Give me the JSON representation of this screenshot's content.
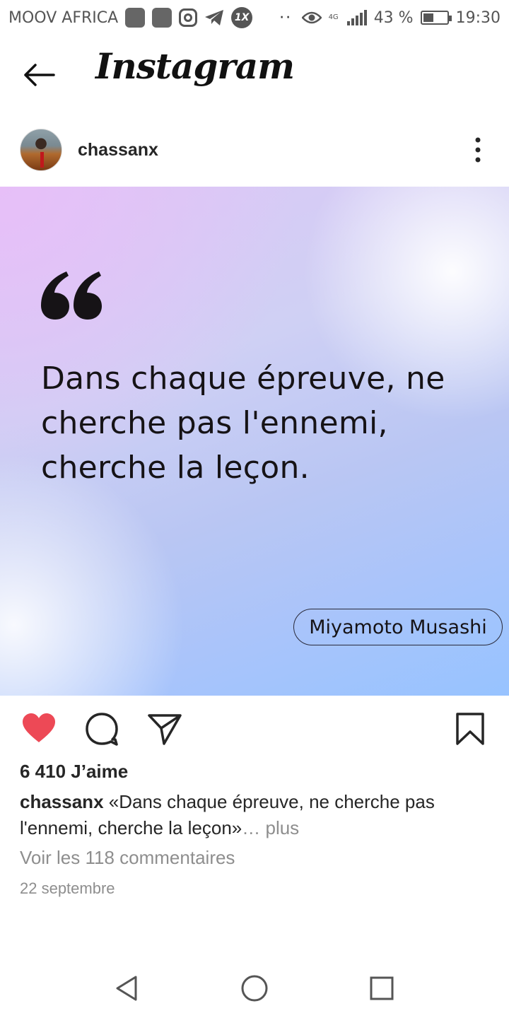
{
  "status_bar": {
    "carrier": "MOOV AFRICA",
    "network": "4G",
    "battery": "43 %",
    "time": "19:30",
    "overflow_dots": "··"
  },
  "app_bar": {
    "title": "Instagram"
  },
  "post": {
    "username": "chassanx",
    "image": {
      "quote": "Dans chaque épreuve, ne cherche pas l'ennemi, cherche la leçon.",
      "author": "Miyamoto Musashi"
    },
    "liked": true,
    "likes": "6 410 J’aime",
    "caption_user": "chassanx",
    "caption_text": " «Dans chaque épreuve, ne cherche pas l'ennemi, cherche la leçon»",
    "caption_more": "… plus",
    "comments_link": "Voir les 118 commentaires",
    "date": "22 septembre"
  },
  "icons": {
    "back": "arrow-left-icon",
    "more": "more-vertical-icon",
    "like": "heart-icon",
    "comment": "comment-icon",
    "share": "send-icon",
    "save": "bookmark-icon",
    "nav_back": "triangle-back-icon",
    "nav_home": "circle-home-icon",
    "nav_recents": "square-recents-icon"
  },
  "colors": {
    "like_red": "#ed4956",
    "text": "#262626",
    "muted": "#8e8e8e"
  }
}
